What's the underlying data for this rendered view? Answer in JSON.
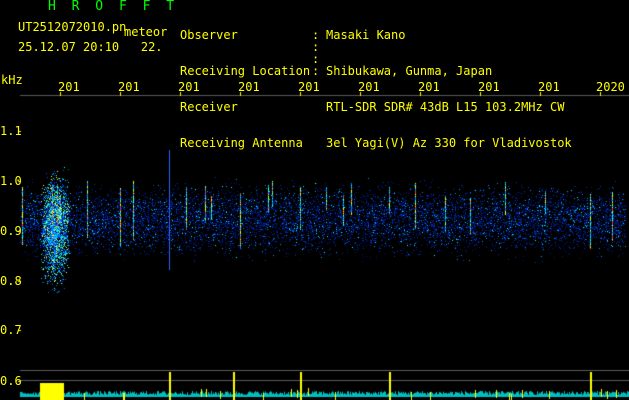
{
  "header": {
    "brand": "H R O F F T",
    "filename": "UT2512072010.pn",
    "meteor_label": "meteor",
    "datetime": "25.12.07 20:10",
    "datetime_suffix": "22."
  },
  "info": {
    "labels": [
      "Observer",
      "Receiving Location",
      "Receiver",
      "Receiving Antenna"
    ],
    "values": [
      "Masaki Kano",
      "Shibukawa, Gunma, Japan",
      "RTL-SDR SDR# 43dB L15 103.2MHz CW",
      "3el Yagi(V) Az 330 for Vladivostok"
    ]
  },
  "axis": {
    "unit": "kHz",
    "y_ticks": [
      "1.1",
      "1.0",
      "0.9",
      "0.8",
      "0.7",
      "0.6"
    ],
    "x_ticks": [
      "201",
      "201",
      "201",
      "201",
      "201",
      "201",
      "201",
      "201",
      "201",
      "2020"
    ]
  },
  "colors": {
    "header_text": "#ffff00",
    "brand": "#00ff00",
    "signal_hot": "#ff3030",
    "signal_mid": "#00ffff",
    "signal_low": "#0040ff",
    "bottom_trace": "#00ffff"
  }
}
